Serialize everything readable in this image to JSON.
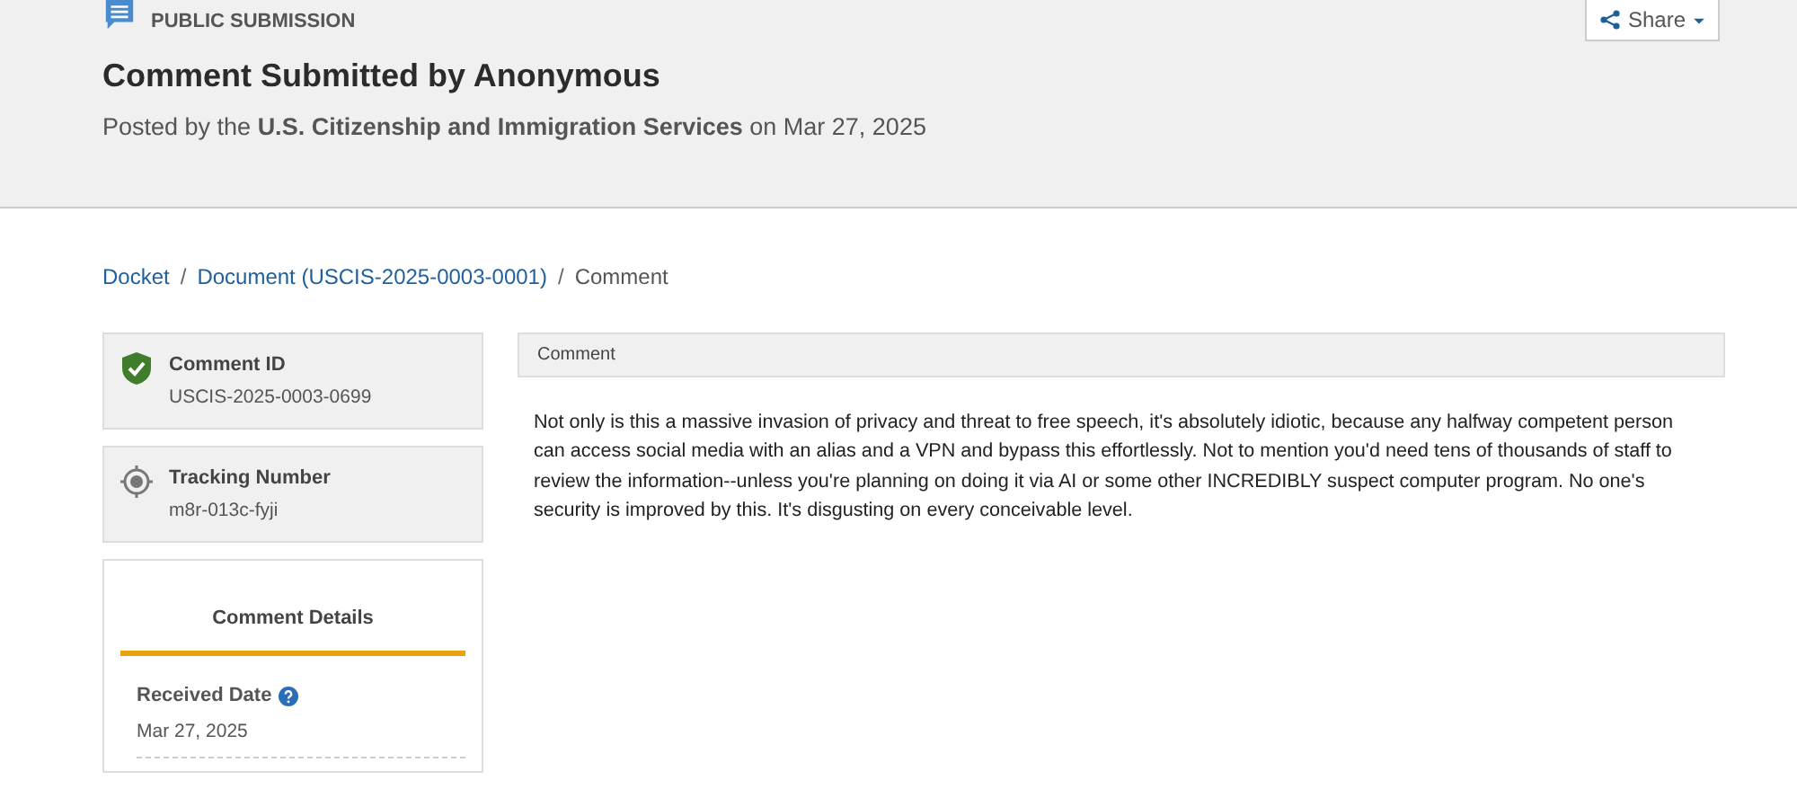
{
  "header": {
    "label": "PUBLIC SUBMISSION",
    "title": "Comment Submitted by Anonymous",
    "subtitle": "Posted by the **U.S. Citizenship and Immigration Services** on Mar 27, 2025",
    "share_button": "Share"
  },
  "breadcrumb": [
    {
      "label": "Docket",
      "kind": "link"
    },
    {
      "separator": "/",
      "label": "Document (USCIS-2025-0003-0001)",
      "kind": "link"
    },
    {
      "separator": "/",
      "label": "Comment",
      "kind": "current"
    }
  ],
  "info_cards": [
    {
      "kind": "shield",
      "label": "Comment ID",
      "value": "USCIS-2025-0003-0699"
    },
    {
      "kind": "target",
      "label": "Tracking Number",
      "value": "m8r-013c-fyji"
    }
  ],
  "details": {
    "title": "Comment Details",
    "fields": [
      {
        "label": "Received Date",
        "value": "Mar 27, 2025",
        "help": true
      }
    ]
  },
  "comment": {
    "heading": "Comment",
    "text": "Not only is this a massive invasion of privacy and threat to free speech, it's absolutely idiotic, because any halfway competent person can access social media with an alias and a VPN and bypass this effortlessly. Not to mention you'd need tens of thousands of staff to review the information--unless you're planning on doing it via AI or some other INCREDIBLY suspect computer program. No one's security is improved by this. It's disgusting on every conceivable level."
  }
}
